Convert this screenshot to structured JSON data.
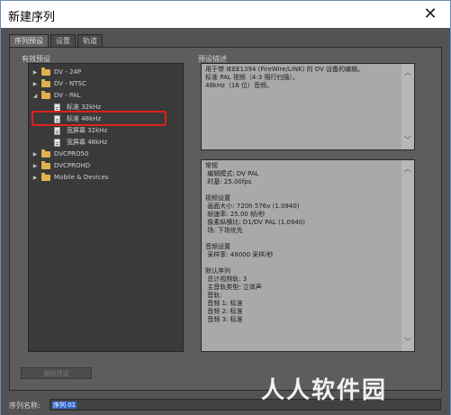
{
  "window": {
    "title": "新建序列",
    "close": "✕"
  },
  "tabs": [
    {
      "label": "序列预设",
      "active": true
    },
    {
      "label": "设置",
      "active": false
    },
    {
      "label": "轨道",
      "active": false
    }
  ],
  "presets_label": "有效预设",
  "description_label": "预设描述",
  "tree": [
    {
      "label": "DV - 24P",
      "type": "folder",
      "expanded": false
    },
    {
      "label": "DV - NTSC",
      "type": "folder",
      "expanded": false
    },
    {
      "label": "DV - PAL",
      "type": "folder",
      "expanded": true
    },
    {
      "label": "标准 32kHz",
      "type": "preset"
    },
    {
      "label": "标准 48kHz",
      "type": "preset",
      "selected": true
    },
    {
      "label": "宽屏幕 32kHz",
      "type": "preset"
    },
    {
      "label": "宽屏幕 48kHz",
      "type": "preset"
    },
    {
      "label": "DVCPRO50",
      "type": "folder",
      "expanded": false
    },
    {
      "label": "DVCPROHD",
      "type": "folder",
      "expanded": false
    },
    {
      "label": "Mobile & Devices",
      "type": "folder",
      "expanded": false
    }
  ],
  "description": "用于带 IEEE1394 (FireWire/LINK) 的 DV 设备的编辑。\n标准 PAL 视频（4:3 隔行扫描）。\n48kHz（16 位）音频。",
  "general": "常规\n 编辑模式: DV PAL\n 时基: 25.00fps\n\n视频设置\n 画面大小: 720h 576v (1.0940)\n 帧速率: 25.00 帧/秒\n 像素纵横比: D1/DV PAL (1.0940)\n 场: 下场优先\n\n音频设置\n 采样率: 48000 采样/秒\n\n默认序列\n 总计视频轨: 3\n 主音轨类型: 立体声\n 音轨:\n 音频 1: 标准\n 音频 2: 标准\n 音频 3: 标准",
  "delete_button": "删除预设",
  "sequence_name_label": "序列名称:",
  "sequence_name_value": "序列 01",
  "watermark": "人人软件园",
  "colors": {
    "panel_bg": "#535353",
    "tree_bg": "#3a3a3a",
    "desc_bg": "#a9a9a9",
    "folder": "#e0b24c",
    "selection_outline": "#e02020"
  }
}
